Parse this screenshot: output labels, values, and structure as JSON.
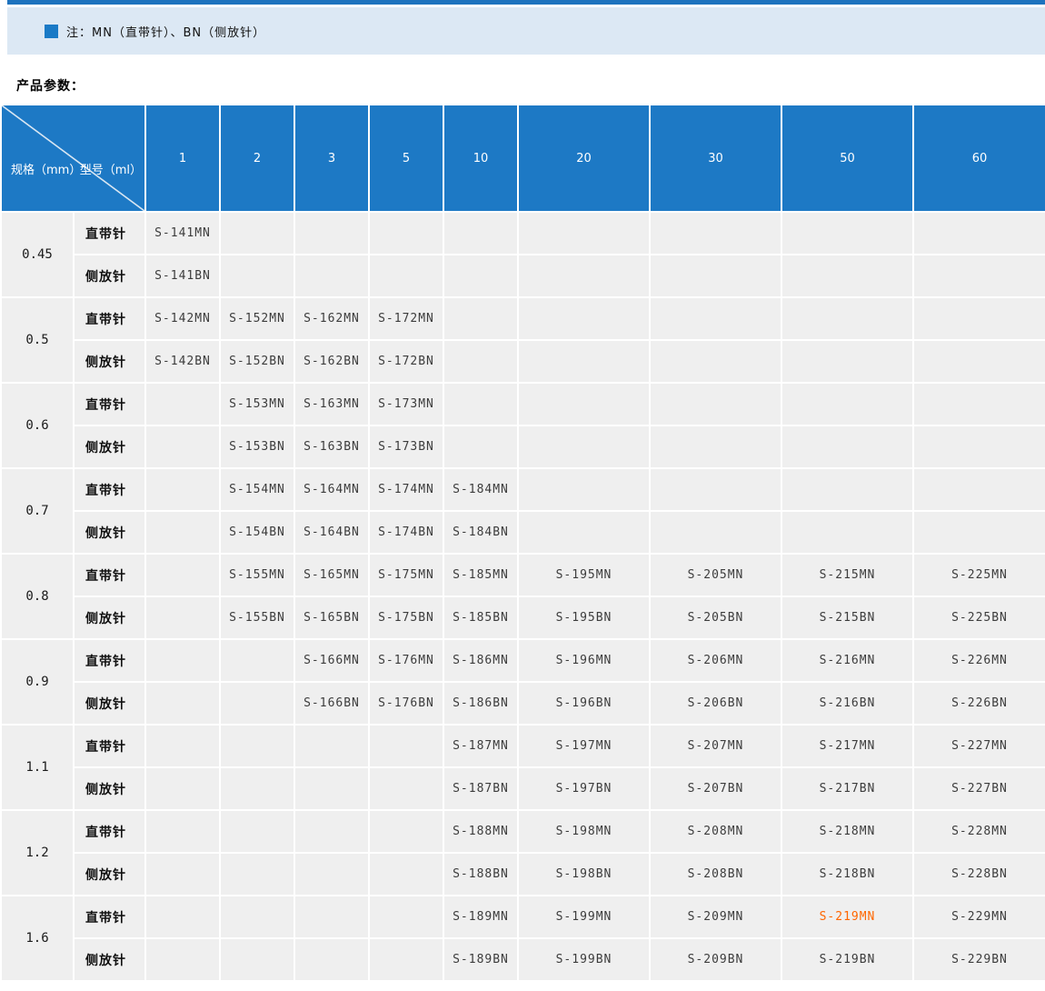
{
  "note": {
    "bullet_icon": "square-bullet",
    "text": "注：MN（直带针）、BN（侧放针）"
  },
  "section_title": "产品参数：",
  "colors": {
    "top_line": "#1e73be",
    "note_bar_bg": "#dce8f4",
    "bullet": "#1a7ac6",
    "header_blue": "#1d79c5",
    "cell_bg": "#efefef",
    "highlight": "#ff6600"
  },
  "table": {
    "corner": {
      "row_label": "规格（mm）",
      "col_label": "型号（ml）"
    },
    "volumes": [
      "1",
      "2",
      "3",
      "5",
      "10",
      "20",
      "30",
      "50",
      "60"
    ],
    "row_types": [
      "直带针",
      "侧放针"
    ],
    "groups": [
      {
        "spec": "0.45",
        "mn": [
          "S-141MN",
          "",
          "",
          "",
          "",
          "",
          "",
          "",
          ""
        ],
        "bn": [
          "S-141BN",
          "",
          "",
          "",
          "",
          "",
          "",
          "",
          ""
        ]
      },
      {
        "spec": "0.5",
        "mn": [
          "S-142MN",
          "S-152MN",
          "S-162MN",
          "S-172MN",
          "",
          "",
          "",
          "",
          ""
        ],
        "bn": [
          "S-142BN",
          "S-152BN",
          "S-162BN",
          "S-172BN",
          "",
          "",
          "",
          "",
          ""
        ]
      },
      {
        "spec": "0.6",
        "mn": [
          "",
          "S-153MN",
          "S-163MN",
          "S-173MN",
          "",
          "",
          "",
          "",
          ""
        ],
        "bn": [
          "",
          "S-153BN",
          "S-163BN",
          "S-173BN",
          "",
          "",
          "",
          "",
          ""
        ]
      },
      {
        "spec": "0.7",
        "mn": [
          "",
          "S-154MN",
          "S-164MN",
          "S-174MN",
          "S-184MN",
          "",
          "",
          "",
          ""
        ],
        "bn": [
          "",
          "S-154BN",
          "S-164BN",
          "S-174BN",
          "S-184BN",
          "",
          "",
          "",
          ""
        ]
      },
      {
        "spec": "0.8",
        "mn": [
          "",
          "S-155MN",
          "S-165MN",
          "S-175MN",
          "S-185MN",
          "S-195MN",
          "S-205MN",
          "S-215MN",
          "S-225MN"
        ],
        "bn": [
          "",
          "S-155BN",
          "S-165BN",
          "S-175BN",
          "S-185BN",
          "S-195BN",
          "S-205BN",
          "S-215BN",
          "S-225BN"
        ]
      },
      {
        "spec": "0.9",
        "mn": [
          "",
          "",
          "S-166MN",
          "S-176MN",
          "S-186MN",
          "S-196MN",
          "S-206MN",
          "S-216MN",
          "S-226MN"
        ],
        "bn": [
          "",
          "",
          "S-166BN",
          "S-176BN",
          "S-186BN",
          "S-196BN",
          "S-206BN",
          "S-216BN",
          "S-226BN"
        ]
      },
      {
        "spec": "1.1",
        "mn": [
          "",
          "",
          "",
          "",
          "S-187MN",
          "S-197MN",
          "S-207MN",
          "S-217MN",
          "S-227MN"
        ],
        "bn": [
          "",
          "",
          "",
          "",
          "S-187BN",
          "S-197BN",
          "S-207BN",
          "S-217BN",
          "S-227BN"
        ]
      },
      {
        "spec": "1.2",
        "mn": [
          "",
          "",
          "",
          "",
          "S-188MN",
          "S-198MN",
          "S-208MN",
          "S-218MN",
          "S-228MN"
        ],
        "bn": [
          "",
          "",
          "",
          "",
          "S-188BN",
          "S-198BN",
          "S-208BN",
          "S-218BN",
          "S-228BN"
        ]
      },
      {
        "spec": "1.6",
        "mn": [
          "",
          "",
          "",
          "",
          "S-189MN",
          "S-199MN",
          "S-209MN",
          "S-219MN",
          "S-229MN"
        ],
        "bn": [
          "",
          "",
          "",
          "",
          "S-189BN",
          "S-199BN",
          "S-209BN",
          "S-219BN",
          "S-229BN"
        ]
      }
    ],
    "highlight": {
      "value": "S-219MN",
      "spec": "1.6",
      "type": "直带针",
      "volume": "50"
    }
  }
}
